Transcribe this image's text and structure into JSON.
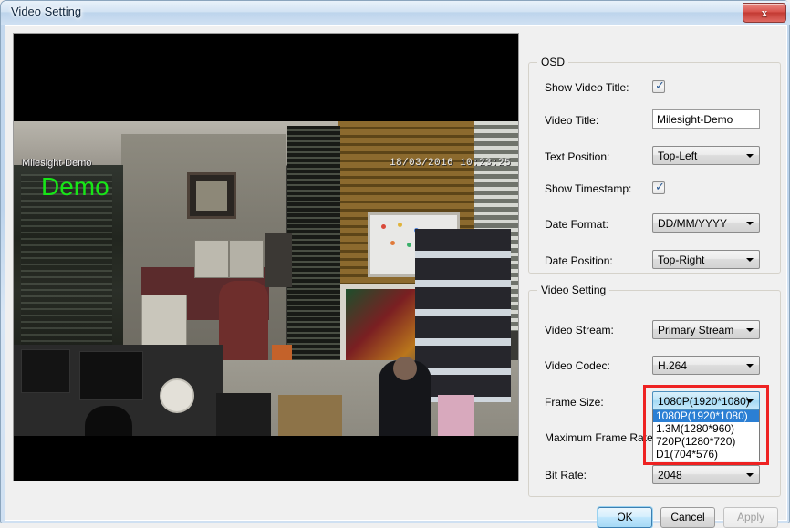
{
  "window": {
    "title": "Video Setting",
    "close_label": "x"
  },
  "video_preview": {
    "osd_title_overlay": "Milesight-Demo",
    "osd_demo_overlay": "Demo",
    "osd_timestamp_overlay": "18/03/2016 10:23:25"
  },
  "osd_group": {
    "legend": "OSD",
    "show_video_title_label": "Show Video Title:",
    "show_video_title_checked": "✓",
    "video_title_label": "Video Title:",
    "video_title_value": "Milesight-Demo",
    "video_title_placeholder": "",
    "text_position_label": "Text Position:",
    "text_position_value": "Top-Left",
    "show_timestamp_label": "Show Timestamp:",
    "show_timestamp_checked": "✓",
    "date_format_label": "Date Format:",
    "date_format_value": "DD/MM/YYYY",
    "date_position_label": "Date Position:",
    "date_position_value": "Top-Right"
  },
  "video_group": {
    "legend": "Video Setting",
    "video_stream_label": "Video Stream:",
    "video_stream_value": "Primary Stream",
    "video_codec_label": "Video Codec:",
    "video_codec_value": "H.264",
    "frame_size_label": "Frame Size:",
    "frame_size_value": "1080P(1920*1080)",
    "maximum_frame_rate_label": "Maximum Frame Rate:",
    "bit_rate_label": "Bit Rate:",
    "bit_rate_value": "2048"
  },
  "frame_size_dropdown": {
    "open": true,
    "options": [
      "1080P(1920*1080)",
      "1.3M(1280*960)",
      "720P(1280*720)",
      "D1(704*576)"
    ],
    "selected_index": 0
  },
  "buttons": {
    "ok": "OK",
    "cancel": "Cancel",
    "apply": "Apply"
  },
  "colors": {
    "highlight_red": "#ee2222",
    "selection_blue": "#2b7fd4",
    "osd_green": "#17e617",
    "titlebar_blue": "#bdd4ec"
  }
}
